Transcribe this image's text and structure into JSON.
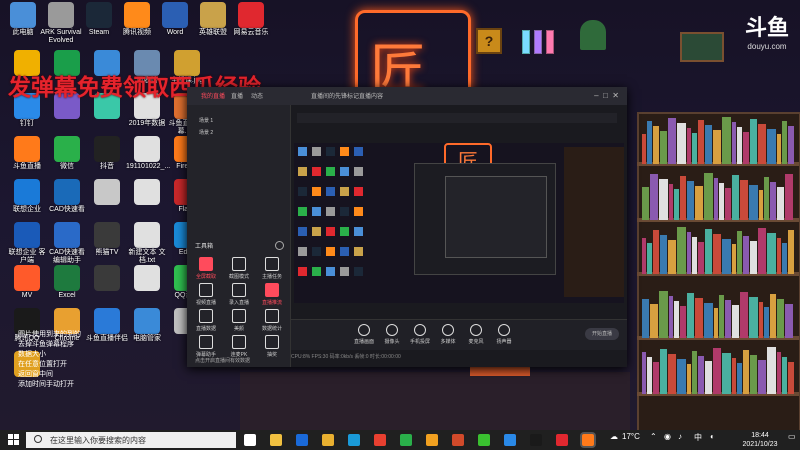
{
  "banner": "发弹幕免费领取西瓜经验",
  "corner_logo": {
    "main": "斗鱼",
    "sub": "douyu.com"
  },
  "wallpaper": {
    "qblock": "?"
  },
  "desktop_icons": [
    {
      "label": "此电脑",
      "color": "#4a8fd8"
    },
    {
      "label": "ARK Survival Evolved",
      "color": "#9a9a9a"
    },
    {
      "label": "Steam",
      "color": "#1b2838"
    },
    {
      "label": "腾讯视频",
      "color": "#ff8a1a"
    },
    {
      "label": "Word",
      "color": "#2b5fb3"
    },
    {
      "label": "英雄联盟",
      "color": "#c9a24a"
    },
    {
      "label": "网易云音乐",
      "color": "#e0282f"
    },
    {
      "label": "",
      "color": "#f0b000"
    },
    {
      "label": "",
      "color": "#1a9e4a"
    },
    {
      "label": "",
      "color": "#3a8ad8"
    },
    {
      "label": "回收站",
      "color": "#6a8ab0"
    },
    {
      "label": "主播课.jpg",
      "color": "#d0a030"
    },
    {
      "label": "钉钉",
      "color": "#2a8ae8"
    },
    {
      "label": "",
      "color": "#7a5ac8"
    },
    {
      "label": "",
      "color": "#3ac8a8"
    },
    {
      "label": "2019年数据",
      "color": "#e0e0e0"
    },
    {
      "label": "斗鱼直播 弹幕.ppt",
      "color": "#e07030"
    },
    {
      "label": "斗鱼直播",
      "color": "#ff7a1a"
    },
    {
      "label": "微信",
      "color": "#2ab04a"
    },
    {
      "label": "抖音",
      "color": "#222"
    },
    {
      "label": "191101022_...",
      "color": "#e0e0e0"
    },
    {
      "label": "Firefox",
      "color": "#ff7a1a"
    },
    {
      "label": "联想企业",
      "color": "#1a7ad8"
    },
    {
      "label": "CAD快速看",
      "color": "#1a6ab8"
    },
    {
      "label": "",
      "color": "#c8c8c8"
    },
    {
      "label": "",
      "color": "#e0e0e0"
    },
    {
      "label": "Flash",
      "color": "#c8282a"
    },
    {
      "label": "联想企业 客户端",
      "color": "#1a5ab8"
    },
    {
      "label": "CAD快速看 编辑助手",
      "color": "#2a6ac8"
    },
    {
      "label": "熊猫TV",
      "color": "#3a3a3a"
    },
    {
      "label": "新建文本 文档.txt",
      "color": "#e0e0e0"
    },
    {
      "label": "Edge",
      "color": "#1a8ad8"
    },
    {
      "label": "MV",
      "color": "#ff5a2a"
    },
    {
      "label": "Excel",
      "color": "#1e7a3e"
    },
    {
      "label": "",
      "color": "#3a3a3a"
    },
    {
      "label": "",
      "color": "#e0e0e0"
    },
    {
      "label": "QQ音乐",
      "color": "#30c050"
    },
    {
      "label": "腾讯QQ",
      "color": "#1a1a1a"
    },
    {
      "label": "Chrome",
      "color": "#e8a030"
    },
    {
      "label": "斗鱼直播伴侣",
      "color": "#2a7ad8"
    },
    {
      "label": "电脑管家",
      "color": "#3a8ad8"
    },
    {
      "label": "",
      "color": "#c0c0c0"
    },
    {
      "label": "",
      "color": "#e0a020"
    }
  ],
  "overlay_text": [
    "图片使用到来的到的",
    "去掉斗鱼弹幕程序",
    "数据大小",
    "在任意位置打开",
    "返回窗中间",
    "添加时间手动打开"
  ],
  "app": {
    "tabs": [
      "我的直播",
      "直播",
      "动态",
      "可靠"
    ],
    "scene_label": "主场景",
    "scene_items": [
      "场景 1",
      "场景 2"
    ],
    "room_title": "直播间的先锋标记直播内容",
    "toolbar_label": "工具箱",
    "tools": [
      {
        "label": "全屏截取",
        "active": true
      },
      {
        "label": "截图模式"
      },
      {
        "label": "主播任务"
      },
      {
        "label": "视频直播"
      },
      {
        "label": "录入直播"
      },
      {
        "label": "直播推流",
        "active": true
      },
      {
        "label": "直播数据"
      },
      {
        "label": "美颜"
      },
      {
        "label": "数据统计"
      },
      {
        "label": "弹幕助手"
      },
      {
        "label": "连麦PK"
      },
      {
        "label": "抽奖"
      }
    ],
    "bottom_buttons": [
      "直播画面",
      "摄像头",
      "手机投屏",
      "多媒体",
      "麦克风",
      "扬声器"
    ],
    "live_button": "开始直播",
    "stats": "CPU:8%  FPS:30  码率:0kb/s  丢帧:0  时长:00:00:00",
    "footer": "点击开启直播间有效数据"
  },
  "taskbar": {
    "search_placeholder": "在这里输入你要搜索的内容",
    "weather": "17°C",
    "lang": "中",
    "time": "18:44",
    "date": "2021/10/23",
    "apps": [
      {
        "name": "task-view",
        "color": "#ffffff"
      },
      {
        "name": "file-explorer",
        "color": "#f0c040"
      },
      {
        "name": "lenovo",
        "color": "#1a6ad8"
      },
      {
        "name": "folder",
        "color": "#e8b030"
      },
      {
        "name": "edge",
        "color": "#1a9ad8"
      },
      {
        "name": "chrome",
        "color": "#e84030"
      },
      {
        "name": "wechat",
        "color": "#2ab04a"
      },
      {
        "name": "qq-browser",
        "color": "#f0a020"
      },
      {
        "name": "ppt",
        "color": "#d04a2a"
      },
      {
        "name": "iqiyi",
        "color": "#3ac030"
      },
      {
        "name": "tencent-video",
        "color": "#2a8ae8"
      },
      {
        "name": "qq",
        "color": "#1a1a1a"
      },
      {
        "name": "netease-music",
        "color": "#e0282f"
      },
      {
        "name": "douyu",
        "color": "#ff7a1a"
      }
    ]
  }
}
